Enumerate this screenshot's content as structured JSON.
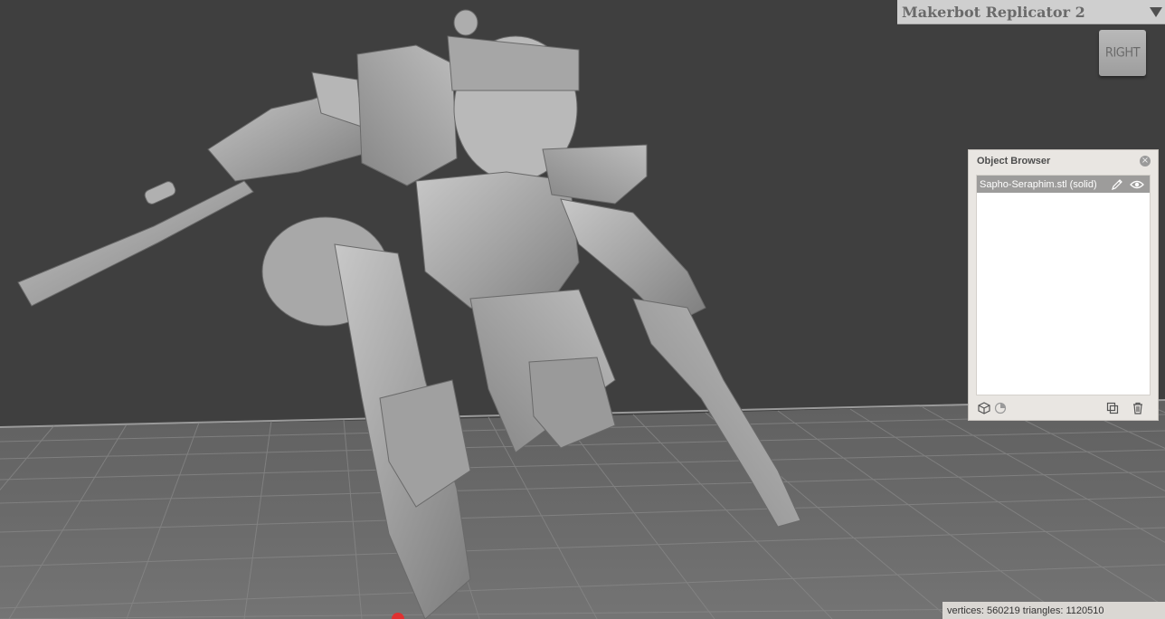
{
  "printer": {
    "name": "Makerbot Replicator 2"
  },
  "view_cube": {
    "face_label": "RIGHT"
  },
  "object_browser": {
    "title": "Object Browser",
    "close_label": "×",
    "items": [
      {
        "label": "Sapho-Seraphim.stl (solid)",
        "selected": true
      }
    ],
    "footer_icons": [
      "cube-icon",
      "pie-chart-icon",
      "duplicate-icon",
      "trash-icon"
    ]
  },
  "status": {
    "text": "vertices: 560219 triangles: 1120510"
  },
  "colors": {
    "background": "#3f3f3f",
    "floor": "#6f6f6f",
    "grid_line": "#8a8a8a",
    "model": "#9b9b9b",
    "panel": "#e9e6e2",
    "selected_row": "#9d9c9b"
  },
  "icons": {
    "printer_dropdown": "chevron-down-icon",
    "item_edit": "edit-icon",
    "item_visibility": "eye-icon"
  }
}
